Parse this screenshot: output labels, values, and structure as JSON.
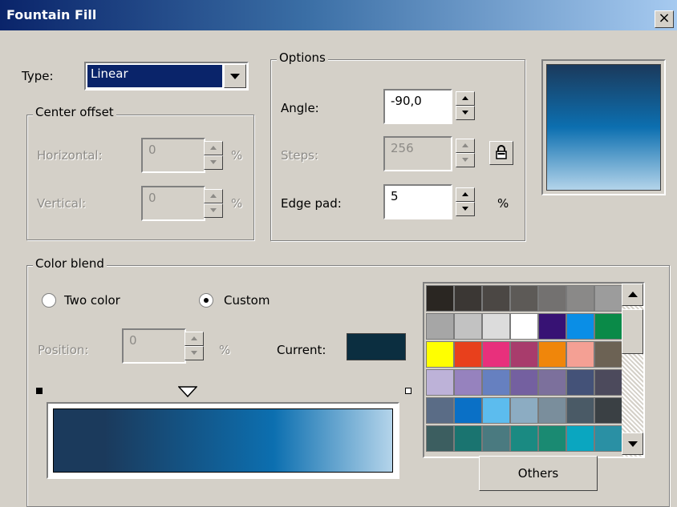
{
  "window": {
    "title": "Fountain Fill",
    "close_symbol": "×"
  },
  "type": {
    "label": "Type:",
    "value": "Linear"
  },
  "center_offset": {
    "label": "Center offset",
    "horizontal_label": "Horizontal:",
    "horizontal_value": "0",
    "vertical_label": "Vertical:",
    "vertical_value": "0",
    "unit": "%"
  },
  "options": {
    "label": "Options",
    "angle_label": "Angle:",
    "angle_value": "-90,0",
    "steps_label": "Steps:",
    "steps_value": "256",
    "edge_pad_label": "Edge pad:",
    "edge_pad_value": "5",
    "unit": "%"
  },
  "color_blend": {
    "label": "Color blend",
    "two_color_label": "Two color",
    "custom_label": "Custom",
    "selected_mode": "Custom",
    "position_label": "Position:",
    "position_value": "0",
    "position_unit": "%",
    "current_label": "Current:",
    "current_color": "#0b2e40"
  },
  "gradient": {
    "start_color": "#1b3a5c",
    "mid_color": "#0c6fb0",
    "end_color": "#b4d4ea"
  },
  "palette": {
    "colors": [
      "#2a2622",
      "#3b3734",
      "#4b4744",
      "#5d5a57",
      "#737170",
      "#8a8988",
      "#9c9c9c",
      "#a6a6a6",
      "#c2c2c2",
      "#dcdcdc",
      "#ffffff",
      "#371274",
      "#0a8ee6",
      "#0a8a48",
      "#ffff00",
      "#e8401c",
      "#e8307c",
      "#a83c6c",
      "#f0860a",
      "#f4a094",
      "#6c6254",
      "#bdb2d8",
      "#9682be",
      "#6680c0",
      "#7460a0",
      "#7c709c",
      "#445278",
      "#4c4a5c",
      "#5a6c86",
      "#0a70c6",
      "#5cbcee",
      "#8cacc2",
      "#7a8e9c",
      "#4a5a66",
      "#3a4044",
      "#3c5e60",
      "#1a7470",
      "#4a7a80",
      "#1a8a82",
      "#1a8a72",
      "#0aa6c0",
      "#2a90a4"
    ],
    "others_button": "Others"
  }
}
